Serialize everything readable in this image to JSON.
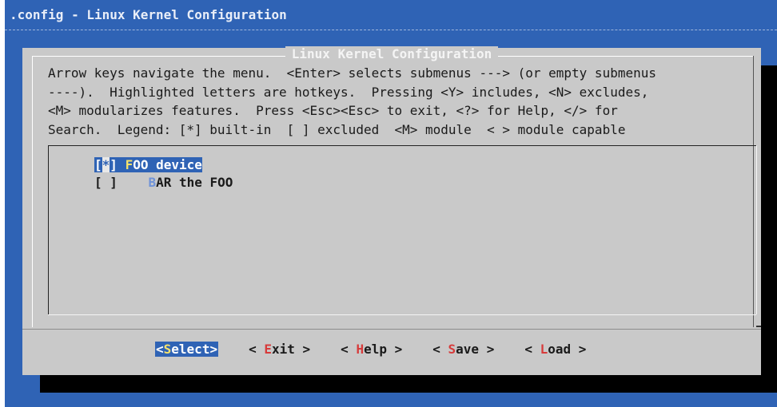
{
  "window": {
    "title": ".config - Linux Kernel Configuration"
  },
  "dialog": {
    "title": "Linux Kernel Configuration",
    "help_lines": [
      "Arrow keys navigate the menu.  <Enter> selects submenus ---> (or empty submenus",
      "----).  Highlighted letters are hotkeys.  Pressing <Y> includes, <N> excludes,",
      "<M> modularizes features.  Press <Esc><Esc> to exit, <?> for Help, </> for",
      "Search.  Legend: [*] built-in  [ ] excluded  <M> module  < > module capable"
    ]
  },
  "menu": {
    "items": [
      {
        "open": "[",
        "mark": "*",
        "close": "]",
        "gap": " ",
        "hotkey": "F",
        "rest": "OO device",
        "selected": true
      },
      {
        "open": "[",
        "mark": " ",
        "close": "]",
        "gap": "    ",
        "hotkey": "B",
        "rest": "AR the FOO",
        "selected": false
      }
    ]
  },
  "buttons": [
    {
      "pre": "<",
      "hotkey": "S",
      "rest": "elect",
      "post": ">"
    },
    {
      "pre": "< ",
      "hotkey": "E",
      "rest": "xit",
      "post": " >"
    },
    {
      "pre": "< ",
      "hotkey": "H",
      "rest": "elp",
      "post": " >"
    },
    {
      "pre": "< ",
      "hotkey": "S",
      "rest": "ave",
      "post": " >"
    },
    {
      "pre": "< ",
      "hotkey": "L",
      "rest": "oad",
      "post": " >"
    }
  ],
  "colors": {
    "background": "#2f63b5",
    "dialog": "#c9c9c9",
    "hotkey_button": "#d73a3a",
    "hotkey_selected": "#f7e26b",
    "hotkey_menu": "#6f93d8"
  }
}
